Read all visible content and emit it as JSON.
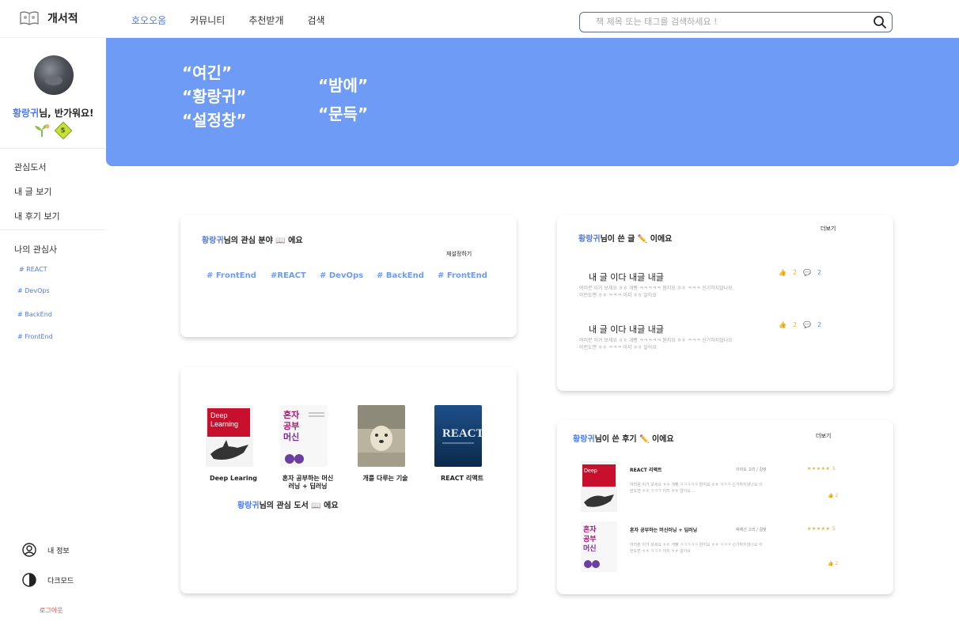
{
  "app": {
    "title": "개서적"
  },
  "nav": {
    "items": [
      "호오오옴",
      "커뮤니티",
      "추천받개",
      "검색"
    ]
  },
  "search": {
    "placeholder": "책 제목 또는 태그를 검색하세요 !"
  },
  "sidebar": {
    "username": "황랑귀",
    "greeting_suffix": "님, 반가워요!",
    "level": "5",
    "menu": [
      "관심도서",
      "내 글 보기",
      "내 후기 보기"
    ],
    "interests_title": "나의 관심사",
    "interests": [
      "# REACT",
      "# DevOps",
      "# BackEnd",
      "# FrontEnd"
    ],
    "my_info": "내 정보",
    "dark_mode": "다크모드",
    "logout": "로그아웃"
  },
  "banner": {
    "lines": [
      "“여긴”",
      "“황랑귀”",
      "“설정창”",
      "“밤에”",
      "“문득”"
    ]
  },
  "interest_card": {
    "title_suffix": "님의 관심 분야 📖 에요",
    "reset": "재설정하기",
    "tags": [
      "# FrontEnd",
      "#REACT",
      "# DevOps",
      "# BackEnd",
      "# FrontEnd"
    ]
  },
  "books_card": {
    "books": [
      {
        "title": "Deep Learing"
      },
      {
        "title": "혼자 공부하는 머신러닝 + 딥러닝"
      },
      {
        "title": "개를 다루는 기술"
      },
      {
        "title": "REACT 리액트"
      }
    ],
    "footer_suffix": "님의 관심 도서 📖 에요"
  },
  "posts_card": {
    "title_suffix": "님이 쓴 글 ✏️ 이에요",
    "more": "더보기",
    "posts": [
      {
        "title": "내 글 이다 내글 내글",
        "body": "여러분 이거 보세요 ㅎㅎ 개빵 ㅋㅋㅋㅋㅋ 뭔지요 ㅎㅎ ㅋㅋㅋ 신기하지않나요 이런도면 ㅎㅎ ㅋㅋㅋ 이지 ㅎㅎ 알아요",
        "likes": "2",
        "comments": "2"
      },
      {
        "title": "내 글 이다 내글 내글",
        "body": "여러분 이거 보세요 ㅎㅎ 개빵 ㅋㅋㅋㅋㅋ 뭔지요 ㅎㅎ ㅋㅋㅋ 신기하지않나요 이런도면 ㅎㅎ ㅋㅋㅋ 이지 ㅎㅎ 알아요",
        "likes": "2",
        "comments": "2"
      }
    ]
  },
  "reviews_card": {
    "title_suffix": "님이 쓴 후기 ✏️ 이에요",
    "more": "더보기",
    "reviews": [
      {
        "title": "REACT 리액트",
        "meta": "이하도 고리 / 길벗",
        "stars": "★★★★★",
        "score": "5",
        "body": "여러분 이거 보세요 ㅎㅎ 개빵 ㅋㅋㅋㅋㅋ 뭔지요 ㅎㅎ ㅋㅋㅋ 신기하지않나요 이런도면 ㅎㅎ ㅋㅋㅋ 이지 ㅎㅎ 알아요 ...",
        "likes": "2"
      },
      {
        "title": "혼자 공부하는 머신러닝 + 딥러닝",
        "meta": "박해선 고리 / 길벗",
        "stars": "★★★★★",
        "score": "5",
        "body": "여러분 이거 보세요 ㅎㅎ 개빵 ㅋㅋㅋㅋㅋ 뭔지요 ㅎㅎ ㅋㅋㅋ 신기하지않나요 이런도면 ㅎㅎ ㅋㅋㅋ 이지 ㅎㅎ 알아요",
        "likes": "2"
      }
    ]
  },
  "colors": {
    "accent": "#4f7bea",
    "banner": "#6e9bf5",
    "like": "#f0b429",
    "comment": "#5b8def",
    "logout": "#e0453d"
  }
}
